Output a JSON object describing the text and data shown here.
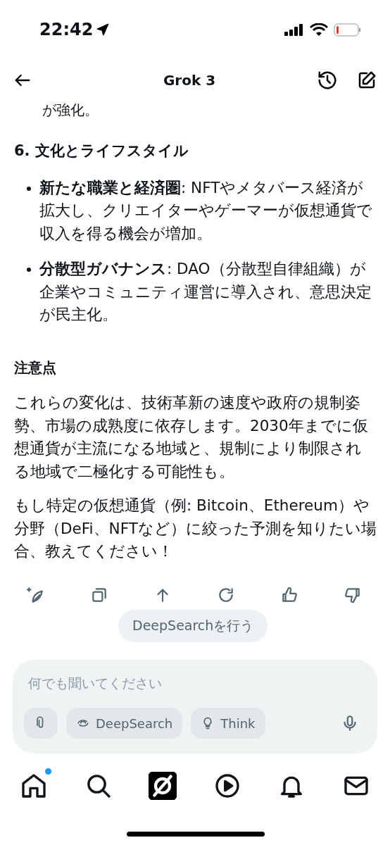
{
  "status_bar": {
    "time": "22:42"
  },
  "header": {
    "title": "Grok 3"
  },
  "message": {
    "cut_line": "が強化。",
    "heading": "6. 文化とライフスタイル",
    "bullets": [
      {
        "text": "**新たな職業と経済圏**: NFTやメタバース経済が拡大し、クリエイターやゲーマーが仮想通貨で収入を得る機会が増加。"
      },
      {
        "text": "**分散型ガバナンス**: DAO（分散型自律組織）が企業やコミュニティ運営に導入され、意思決定が民主化。"
      }
    ],
    "subheading": "注意点",
    "paragraphs": [
      "これらの変化は、技術革新の速度や政府の規制姿勢、市場の成熟度に依存します。2030年までに仮想通貨が主流になる地域と、規制により制限される地域で二極化する可能性も。",
      "もし特定の仮想通貨（例: Bitcoin、Ethereum）や分野（DeFi、NFTなど）に絞った予測を知りたい場合、教えてください！"
    ]
  },
  "actions": [
    {
      "kind": "new"
    },
    {
      "kind": "copy"
    },
    {
      "kind": "share"
    },
    {
      "kind": "regenerate"
    },
    {
      "kind": "like"
    },
    {
      "kind": "dislike"
    }
  ],
  "suggestion": "DeepSearchを行う",
  "composer": {
    "placeholder": "何でも聞いてください",
    "chips": [
      {
        "kind": "attach"
      },
      {
        "kind": "deepsearch",
        "label": "DeepSearch"
      },
      {
        "kind": "think",
        "label": "Think"
      }
    ]
  },
  "nav": [
    {
      "kind": "home",
      "selected": false,
      "badge": true
    },
    {
      "kind": "search",
      "selected": false,
      "badge": false
    },
    {
      "kind": "grok",
      "selected": true,
      "badge": false
    },
    {
      "kind": "video",
      "selected": false,
      "badge": false
    },
    {
      "kind": "bell",
      "selected": false,
      "badge": false
    },
    {
      "kind": "mail",
      "selected": false,
      "badge": false
    }
  ]
}
